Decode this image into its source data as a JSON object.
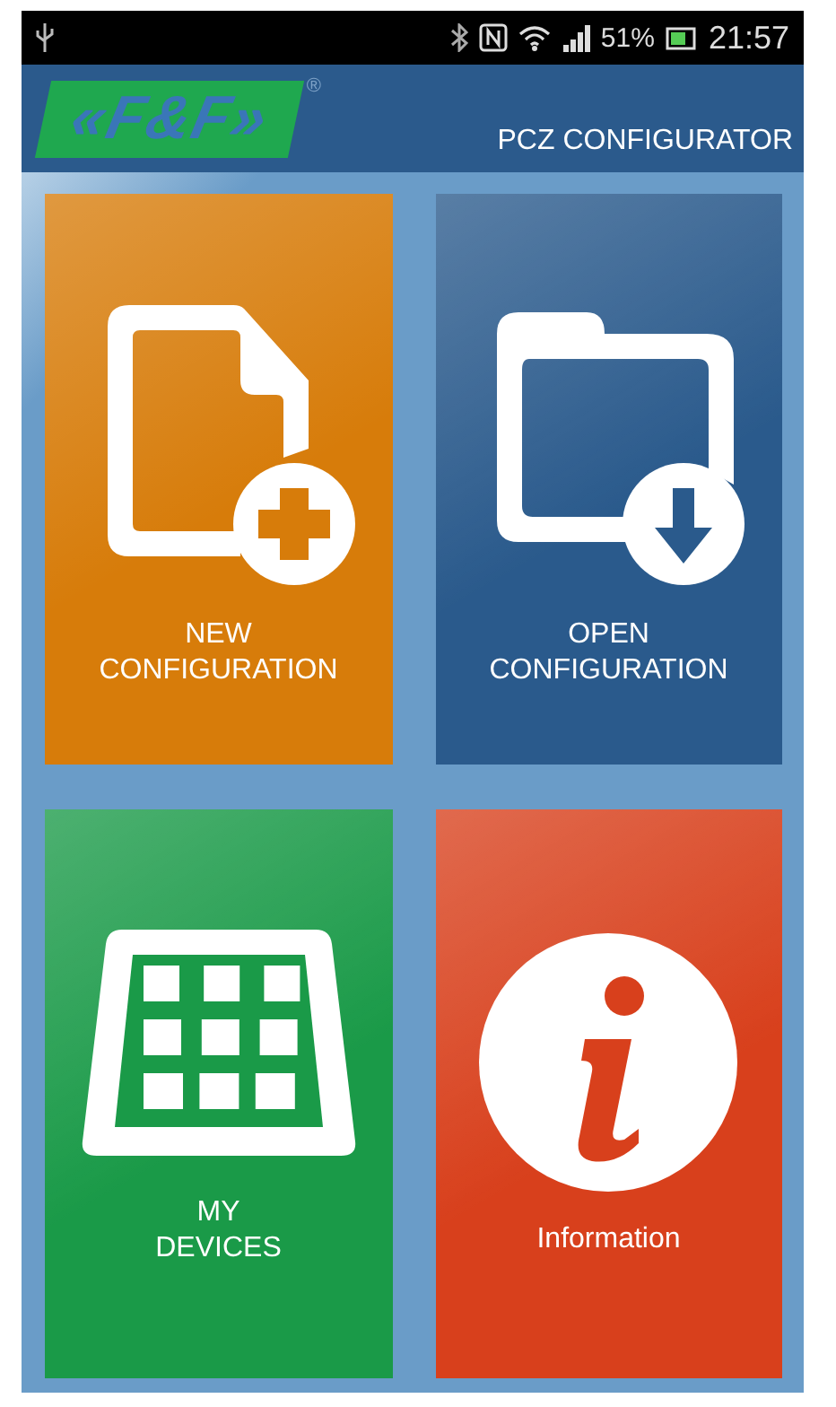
{
  "status_bar": {
    "battery_percent": "51%",
    "time": "21:57"
  },
  "header": {
    "logo": "«F&F»",
    "registered": "®",
    "title": "PCZ CONFIGURATOR"
  },
  "tiles": [
    {
      "kind": "new",
      "label": "NEW\nCONFIGURATION",
      "color": "#d77c0a"
    },
    {
      "kind": "open",
      "label": "OPEN\nCONFIGURATION",
      "color": "#2a5a8c"
    },
    {
      "kind": "devices",
      "label": "MY\nDEVICES",
      "color": "#1a9a48"
    },
    {
      "kind": "info",
      "label": "Information",
      "color": "#d8401c"
    }
  ]
}
